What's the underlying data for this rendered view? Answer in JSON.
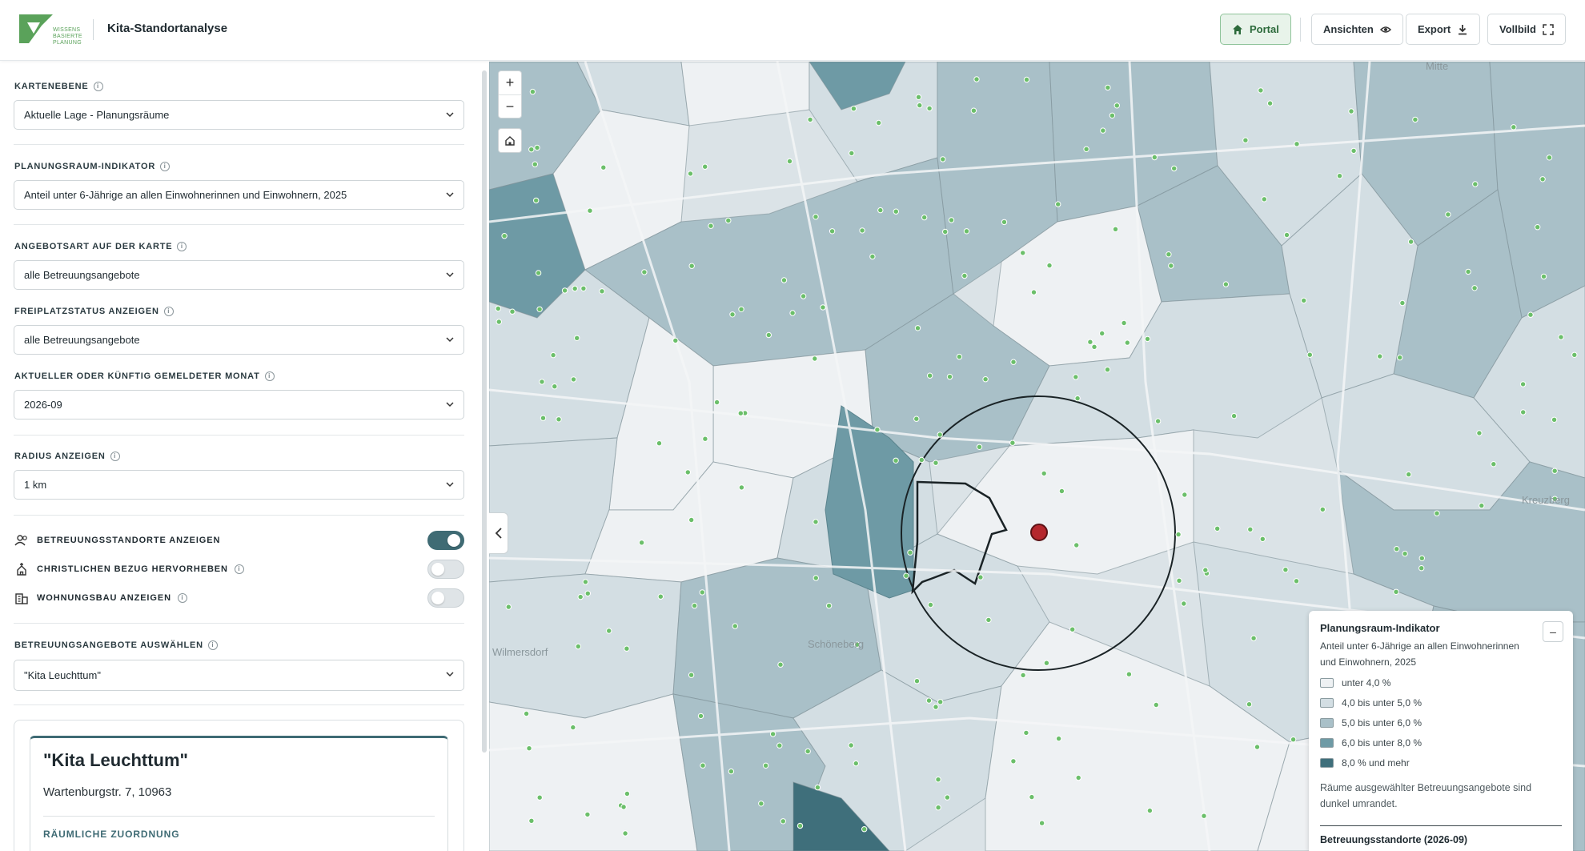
{
  "header": {
    "logo_lines": [
      "WISSENS",
      "BASIERTE",
      "PLANUNG"
    ],
    "app_title": "Kita-Standortanalyse",
    "buttons": {
      "portal": "Portal",
      "ansichten": "Ansichten",
      "export": "Export",
      "vollbild": "Vollbild"
    }
  },
  "sidebar": {
    "kartenebene": {
      "label": "KARTENEBENE",
      "value": "Aktuelle Lage - Planungsräume"
    },
    "indikator": {
      "label": "PLANUNGSRAUM-INDIKATOR",
      "value": "Anteil unter 6-Jährige an allen Einwohnerinnen und Einwohnern, 2025"
    },
    "angebotsart": {
      "label": "ANGEBOTSART AUF DER KARTE",
      "value": "alle Betreuungsangebote"
    },
    "freiplatz": {
      "label": "FREIPLATZSTATUS ANZEIGEN",
      "value": "alle Betreuungsangebote"
    },
    "monat": {
      "label": "AKTUELLER ODER KÜNFTIG GEMELDETER MONAT",
      "value": "2026-09"
    },
    "radius": {
      "label": "RADIUS ANZEIGEN",
      "value": "1 km"
    },
    "toggles": [
      {
        "label": "BETREUUNGSSTANDORTE ANZEIGEN",
        "on": true,
        "icon": "people-icon"
      },
      {
        "label": "CHRISTLICHEN BEZUG HERVORHEBEN",
        "on": false,
        "icon": "church-icon"
      },
      {
        "label": "WOHNUNGSBAU ANZEIGEN",
        "on": false,
        "icon": "building-icon"
      }
    ],
    "auswahl": {
      "label": "BETREUUNGSANGEBOTE AUSWÄHLEN",
      "value": "\"Kita Leuchttum\""
    },
    "card": {
      "title": "\"Kita Leuchttum\"",
      "address": "Wartenburgstr. 7, 10963",
      "section": "RÄUMLICHE ZUORDNUNG"
    }
  },
  "map": {
    "controls": {
      "zoom_in": "+",
      "zoom_out": "−"
    },
    "labels": {
      "wilmersdorf": "Wilmersdorf",
      "schoeneberg": "Schöneberg",
      "kreuzberg": "Kreuzberg",
      "mitte": "Mitte"
    },
    "selected_color": "#b5272d",
    "legend": {
      "title": "Planungsraum-Indikator",
      "subtitle": "Anteil unter 6-Jährige an allen Einwohnerinnen und Einwohnern, 2025",
      "minimize": "–",
      "classes": [
        {
          "label": "unter 4,0 %",
          "color": "#eef1f3"
        },
        {
          "label": "4,0 bis unter 5,0 %",
          "color": "#d3dee3"
        },
        {
          "label": "5,0 bis unter 6,0 %",
          "color": "#a9c0c8"
        },
        {
          "label": "6,0 bis unter 8,0 %",
          "color": "#6e9aa5"
        },
        {
          "label": "8,0 % und mehr",
          "color": "#3f6f7b"
        }
      ],
      "note": "Räume ausgewählter Betreuungsangebote sind dunkel umrandet.",
      "footer": "Betreuungsstandorte (2026-09)"
    }
  }
}
